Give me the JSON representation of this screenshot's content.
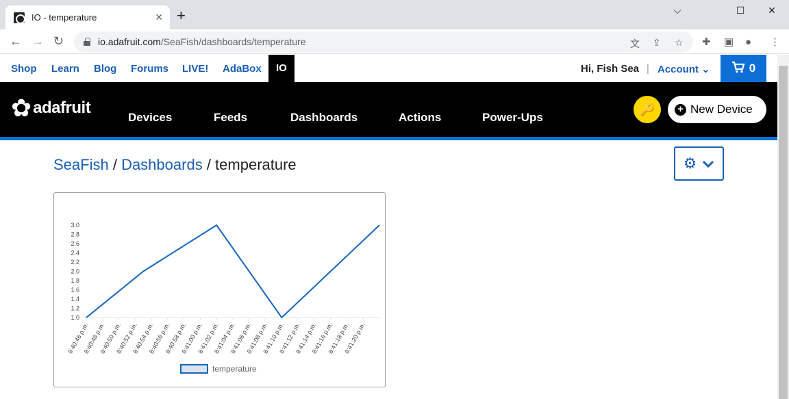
{
  "browser": {
    "tab_title": "IO - temperature",
    "tab_close": "✕",
    "new_tab": "+",
    "url_host": "io.adafruit.com",
    "url_path": "/SeaFish/dashboards/temperature",
    "window_controls": [
      "⌵",
      "☐",
      "✕"
    ]
  },
  "toplinks": [
    {
      "label": "Shop"
    },
    {
      "label": "Learn"
    },
    {
      "label": "Blog"
    },
    {
      "label": "Forums"
    },
    {
      "label": "LIVE!"
    },
    {
      "label": "AdaBox"
    },
    {
      "label": "IO",
      "active": true
    }
  ],
  "user": {
    "greeting": "Hi, Fish Sea",
    "separator": "|",
    "account": "Account ⌄",
    "cart_count": "0"
  },
  "nav": {
    "logo_text": "adafruit",
    "items": [
      {
        "label": "Devices"
      },
      {
        "label": "Feeds"
      },
      {
        "label": "Dashboards"
      },
      {
        "label": "Actions"
      },
      {
        "label": "Power-Ups"
      }
    ],
    "new_device": "New Device"
  },
  "breadcrumb": {
    "user": "SeaFish",
    "sep1": " / ",
    "section": "Dashboards",
    "sep2": " / ",
    "current": "temperature"
  },
  "colors": {
    "brand_blue": "#0d6fd6",
    "link_blue": "#1a5fb4",
    "key_yellow": "#ffd600",
    "series_line": "#1565c0"
  },
  "chart_data": {
    "type": "line",
    "x": [
      "8:40:46 p.m.",
      "8:40:48 p.m.",
      "8:40:50 p.m.",
      "8:40:52 p.m.",
      "8:40:54 p.m.",
      "8:40:56 p.m.",
      "8:40:58 p.m.",
      "8:41:00 p.m.",
      "8:41:02 p.m.",
      "8:41:04 p.m.",
      "8:41:06 p.m.",
      "8:41:08 p.m.",
      "8:41:10 p.m.",
      "8:41:12 p.m.",
      "8:41:14 p.m.",
      "8:41:16 p.m.",
      "8:41:18 p.m.",
      "8:41:20 p.m."
    ],
    "series": [
      {
        "name": "temperature",
        "points": [
          [
            "8:40:46 p.m.",
            1.0
          ],
          [
            "8:40:53 p.m.",
            2.0
          ],
          [
            "8:41:02 p.m.",
            3.0
          ],
          [
            "8:41:10 p.m.",
            1.0
          ],
          [
            "8:41:22 p.m.",
            3.0
          ]
        ]
      }
    ],
    "y_ticks": [
      "1.0",
      "1.2",
      "1.4",
      "1.6",
      "1.8",
      "2.0",
      "2.2",
      "2.4",
      "2.6",
      "2.8",
      "3.0"
    ],
    "ylim": [
      1.0,
      3.0
    ],
    "grid": false,
    "legend_position": "bottom"
  }
}
